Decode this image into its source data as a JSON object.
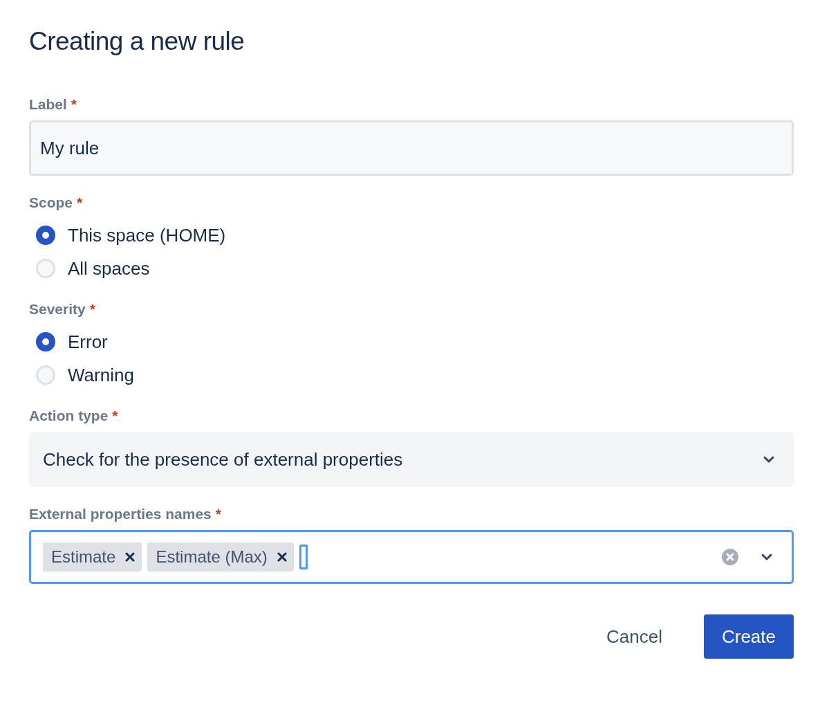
{
  "dialog": {
    "title": "Creating a new rule"
  },
  "fields": [
    {
      "kind": "text",
      "label": "Label",
      "required_mark": "*",
      "value": "My rule"
    },
    {
      "kind": "radio",
      "label": "Scope",
      "required_mark": "*",
      "options": [
        {
          "label": "This space (HOME)",
          "selected": true
        },
        {
          "label": "All spaces",
          "selected": false
        }
      ]
    },
    {
      "kind": "radio",
      "label": "Severity",
      "required_mark": "*",
      "options": [
        {
          "label": "Error",
          "selected": true
        },
        {
          "label": "Warning",
          "selected": false
        }
      ]
    },
    {
      "kind": "select",
      "label": "Action type",
      "required_mark": "*",
      "value": "Check for the presence of external properties"
    },
    {
      "kind": "multiselect",
      "label": "External properties names",
      "required_mark": "*",
      "tags": [
        "Estimate",
        "Estimate (Max)"
      ],
      "focused": true
    }
  ],
  "buttons": [
    {
      "label": "Cancel",
      "kind": "subtle"
    },
    {
      "label": "Create",
      "kind": "primary"
    }
  ]
}
